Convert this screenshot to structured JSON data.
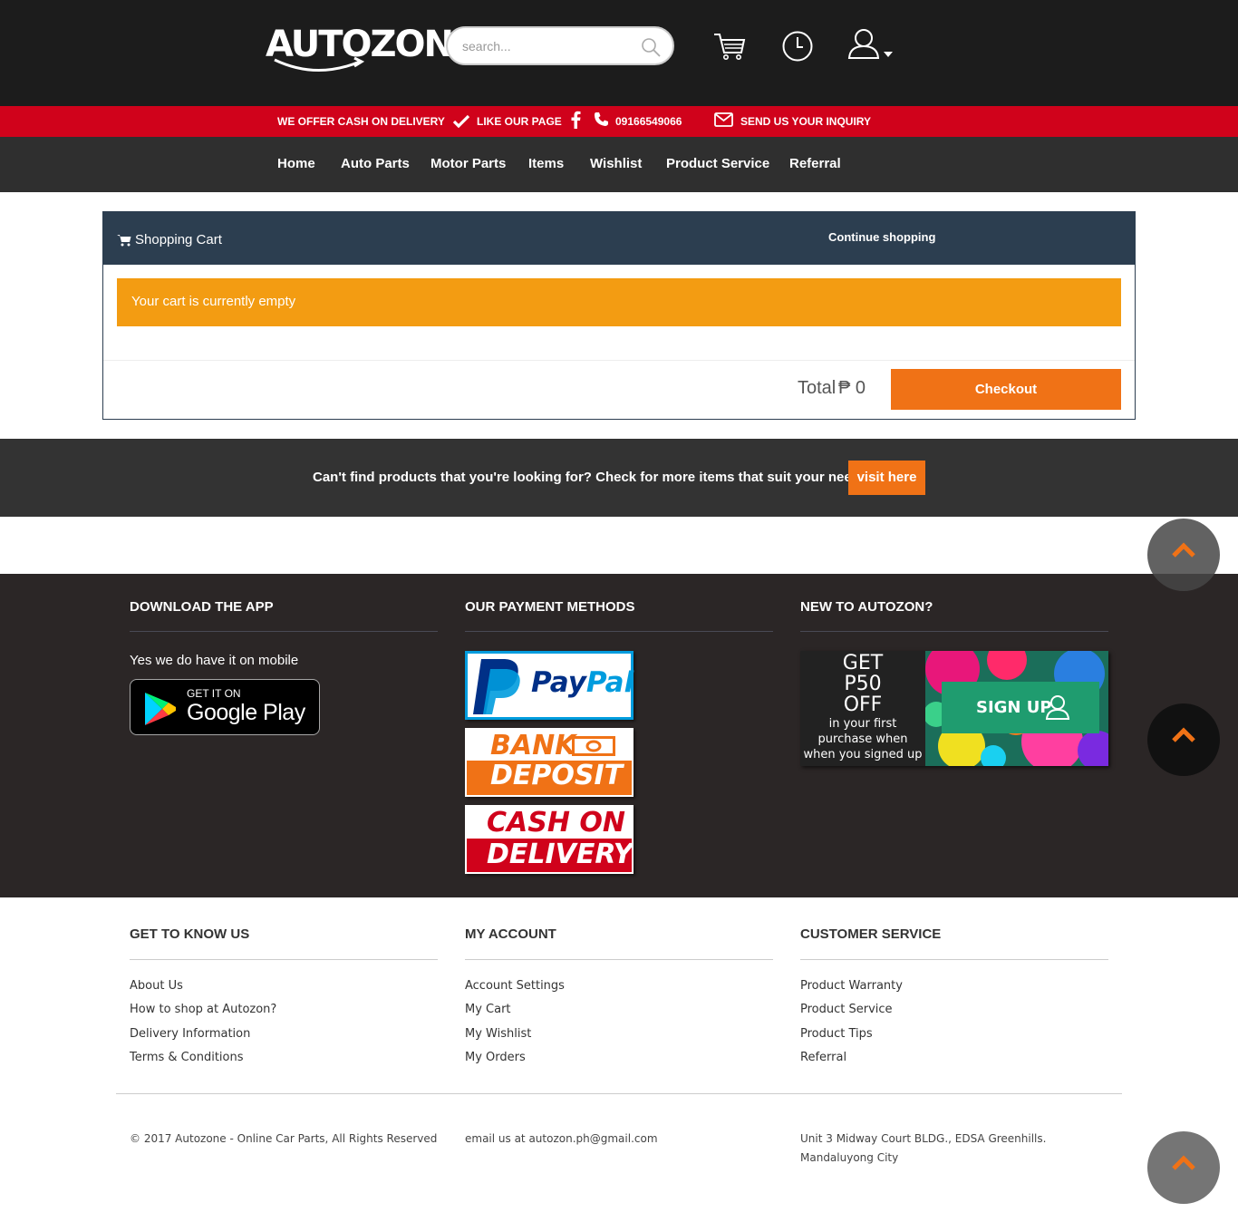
{
  "header": {
    "logo": "AUTOZON",
    "search_placeholder": "search..."
  },
  "infobar": {
    "cod": "WE OFFER CASH ON DELIVERY",
    "like": "LIKE OUR PAGE",
    "phone": "09166549066",
    "inquiry": "SEND US YOUR INQUIRY"
  },
  "nav": [
    "Home",
    "Auto Parts",
    "Motor Parts",
    "Items",
    "Wishlist",
    "Product Service",
    "Referral"
  ],
  "cart": {
    "title": "Shopping Cart",
    "continue": "Continue shopping",
    "empty_message": "Your cart is currently empty",
    "total_label": "Total",
    "total_amount": "₱ 0",
    "checkout": "Checkout"
  },
  "find": {
    "message": "Can't find products that you're looking for? Check for more items that suit your needs.",
    "button": "visit here"
  },
  "dark_footer": {
    "app_heading": "DOWNLOAD THE APP",
    "app_sub": "Yes we do have it on mobile",
    "gplay_line1": "GET IT ON",
    "gplay_line2": "Google Play",
    "payment_heading": "OUR PAYMENT METHODS",
    "paypal_a": "Pay",
    "paypal_b": "Pal",
    "bank_1": "BANK",
    "bank_2": "DEPOSIT",
    "cod_1": "CASH ON",
    "cod_2": "DELIVERY",
    "new_heading": "NEW TO AUTOZON?",
    "promo_get": "GET",
    "promo_amount": "P50",
    "promo_off": "OFF",
    "promo_small": "in your first purchase when when you signed up",
    "signup": "SIGN UP"
  },
  "footer": {
    "col1": {
      "heading": "GET TO KNOW US",
      "links": [
        "About Us",
        "How to shop at Autozon?",
        "Delivery Information",
        "Terms & Conditions"
      ]
    },
    "col2": {
      "heading": "MY ACCOUNT",
      "links": [
        "Account Settings",
        "My Cart",
        "My Wishlist",
        "My Orders"
      ]
    },
    "col3": {
      "heading": "CUSTOMER SERVICE",
      "links": [
        "Product Warranty",
        "Product Service",
        "Product Tips",
        "Referral"
      ]
    },
    "copyright": "© 2017 Autozone - Online Car Parts, All Rights Reserved",
    "email": "email us at autozon.ph@gmail.com",
    "address_1": "Unit 3 Midway Court BLDG., EDSA Greenhills.",
    "address_2": "Mandaluyong City"
  },
  "colors": {
    "red": "#d0021b",
    "orange": "#f07216",
    "alert": "#f39c12",
    "cart_header": "#2c3e50"
  }
}
